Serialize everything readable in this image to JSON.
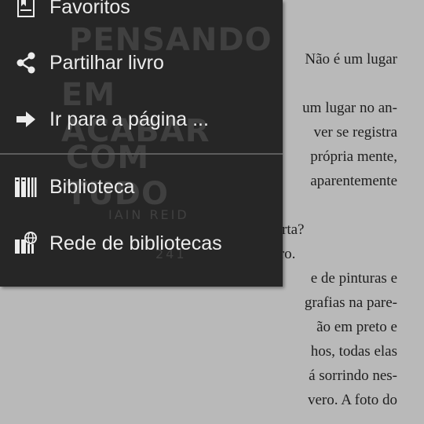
{
  "menu": {
    "items": [
      {
        "label": "Favoritos",
        "icon": "bookmark-icon"
      },
      {
        "label": "Partilhar livro",
        "icon": "share-icon"
      },
      {
        "label": "Ir para a página ...",
        "icon": "arrow-right-icon"
      },
      {
        "label": "Biblioteca",
        "icon": "library-icon"
      },
      {
        "label": "Rede de bibliotecas",
        "icon": "network-library-icon"
      }
    ]
  },
  "book": {
    "lines": [
      "Não é um lugar",
      "",
      "um lugar no an-",
      "ver se registra",
      "própria mente,",
      "aparentemente",
      "",
      "porta?",
      "orro.",
      "e de pinturas e",
      "grafias na pare-",
      "ão em preto e",
      "hos, todas elas",
      "á sorrindo nes-",
      "vero. A foto do"
    ]
  },
  "cover": {
    "title_lines": [
      "PENSANDO",
      "EM ACABAR",
      "COM TUDO"
    ],
    "author": "IAIN REID",
    "code": "241"
  },
  "colors": {
    "menu_bg": "#262626",
    "page_bg": "#b9b9b9",
    "text": "#ececec"
  }
}
